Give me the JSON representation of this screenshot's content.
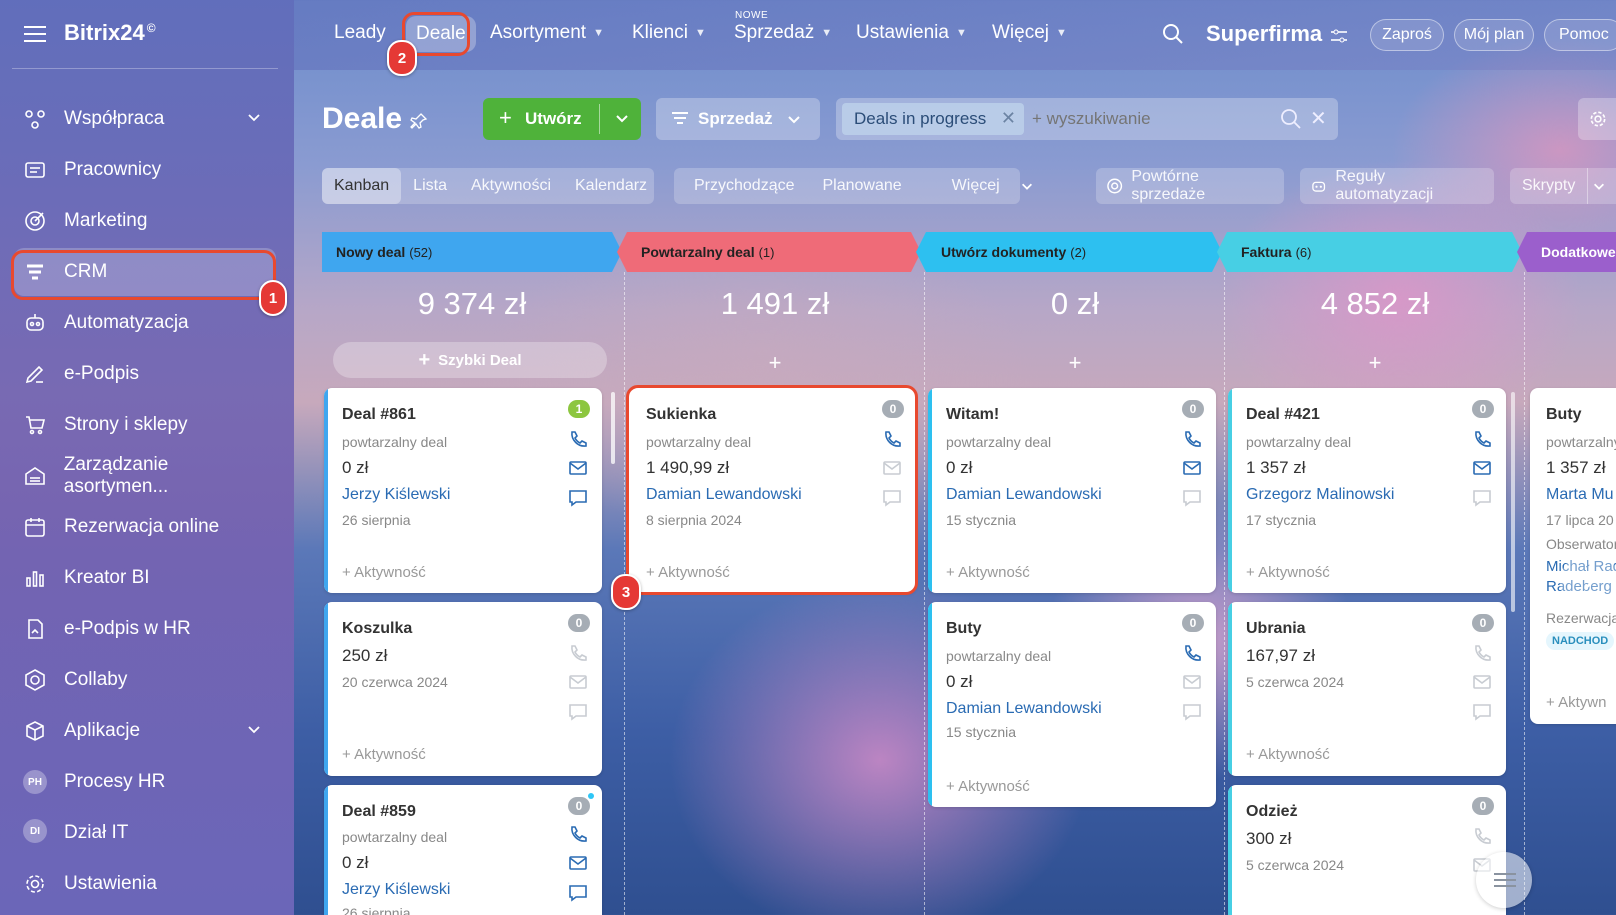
{
  "sidebar": {
    "logo": "Bitrix24",
    "logo_mark": "©",
    "items": [
      {
        "label": "Współpraca",
        "icon": "collaboration-icon"
      },
      {
        "label": "Pracownicy",
        "icon": "employees-icon"
      },
      {
        "label": "Marketing",
        "icon": "marketing-icon"
      },
      {
        "label": "CRM",
        "icon": "crm-icon"
      },
      {
        "label": "Automatyzacja",
        "icon": "automation-icon"
      },
      {
        "label": "e-Podpis",
        "icon": "pen-icon"
      },
      {
        "label": "Strony i sklepy",
        "icon": "cart-icon"
      },
      {
        "label": "Zarządzanie asortymen...",
        "icon": "warehouse-icon"
      },
      {
        "label": "Rezerwacja online",
        "icon": "calendar-icon"
      },
      {
        "label": "Kreator BI",
        "icon": "chart-icon"
      },
      {
        "label": "e-Podpis w HR",
        "icon": "doc-sign-icon"
      },
      {
        "label": "Collaby",
        "icon": "collaby-icon"
      },
      {
        "label": "Aplikacje",
        "icon": "apps-icon"
      },
      {
        "label": "Procesy HR",
        "avatar": "PH"
      },
      {
        "label": "Dział IT",
        "avatar": "DI"
      },
      {
        "label": "Ustawienia",
        "icon": "gear-icon"
      }
    ]
  },
  "topnav": {
    "items": [
      "Leady",
      "Deale",
      "Asortyment",
      "Klienci",
      "Sprzedaż",
      "Ustawienia",
      "Więcej"
    ],
    "new_badge": "NOWE",
    "company": "Superfirma",
    "invite": "Zaproś",
    "plan": "Mój plan",
    "help": "Pomoc"
  },
  "toolbar": {
    "title": "Deale",
    "create": "Utwórz",
    "pipeline": "Sprzedaż",
    "filter_tag": "Deals in progress",
    "search_placeholder": "+ wyszukiwanie"
  },
  "views": [
    "Kanban",
    "Lista",
    "Aktywności",
    "Kalendarz"
  ],
  "filters": [
    "Przychodzące",
    "Planowane",
    "Więcej"
  ],
  "actions": {
    "repeat": "Powtórne sprzedaże",
    "rules": "Reguły automatyzacji",
    "scripts": "Skrypty"
  },
  "annotations": [
    "1",
    "2",
    "3"
  ],
  "colors": {
    "green": "#4fb23a",
    "blue_col": "#3fa6ef",
    "red_col": "#ef6b78",
    "cyan_col": "#2dc0f0",
    "teal_col": "#47cfe4",
    "purple_col": "#9b5fcc",
    "highlight": "#e8492f"
  },
  "columns": [
    {
      "title": "Nowy deal",
      "count": "(52)",
      "sum": "9 374 zł",
      "quick": "Szybki Deal",
      "cards": [
        {
          "title": "Deal #861",
          "sub": "powtarzalny deal",
          "amount": "0 zł",
          "person": "Jerzy Kiślewski",
          "date": "26 sierpnia",
          "activity": "+ Aktywność",
          "badge": "1"
        },
        {
          "title": "Koszulka",
          "amount": "250 zł",
          "date": "20 czerwca 2024",
          "activity": "+ Aktywność",
          "badge": "0"
        },
        {
          "title": "Deal #859",
          "sub": "powtarzalny deal",
          "amount": "0 zł",
          "person": "Jerzy Kiślewski",
          "date": "26 sierpnia",
          "badge": "0"
        }
      ]
    },
    {
      "title": "Powtarzalny deal",
      "count": "(1)",
      "sum": "1 491 zł",
      "plus": "+",
      "cards": [
        {
          "title": "Sukienka",
          "sub": "powtarzalny deal",
          "amount": "1 490,99 zł",
          "person": "Damian Lewandowski",
          "date": "8 sierpnia 2024",
          "activity": "+ Aktywność",
          "badge": "0"
        }
      ]
    },
    {
      "title": "Utwórz dokumenty",
      "count": "(2)",
      "sum": "0 zł",
      "plus": "+",
      "cards": [
        {
          "title": "Witam!",
          "sub": "powtarzalny deal",
          "amount": "0 zł",
          "person": "Damian Lewandowski",
          "date": "15 stycznia",
          "activity": "+ Aktywność",
          "badge": "0"
        },
        {
          "title": "Buty",
          "sub": "powtarzalny deal",
          "amount": "0 zł",
          "person": "Damian Lewandowski",
          "date": "15 stycznia",
          "activity": "+ Aktywność",
          "badge": "0"
        }
      ]
    },
    {
      "title": "Faktura",
      "count": "(6)",
      "sum": "4 852 zł",
      "plus": "+",
      "cards": [
        {
          "title": "Deal #421",
          "sub": "powtarzalny deal",
          "amount": "1 357 zł",
          "person": "Grzegorz Malinowski",
          "date": "17 stycznia",
          "activity": "+ Aktywność",
          "badge": "0"
        },
        {
          "title": "Ubrania",
          "amount": "167,97 zł",
          "date": "5 czerwca 2024",
          "activity": "+ Aktywność",
          "badge": "0"
        },
        {
          "title": "Odzież",
          "amount": "300 zł",
          "date": "5 czerwca 2024",
          "badge": "0"
        }
      ]
    },
    {
      "title": "Dodatkowe",
      "cards": [
        {
          "title": "Buty",
          "sub": "powtarzalny",
          "amount": "1 357 zł",
          "person": "Marta Mu",
          "date": "17 lipca 20",
          "observer": "Obserwator",
          "observer_name1": "Michał Rad",
          "observer_name2": "Radeberg",
          "reserve": "Rezerwacja",
          "tag": "NADCHOD",
          "activity": "+ Aktywn"
        }
      ]
    }
  ]
}
